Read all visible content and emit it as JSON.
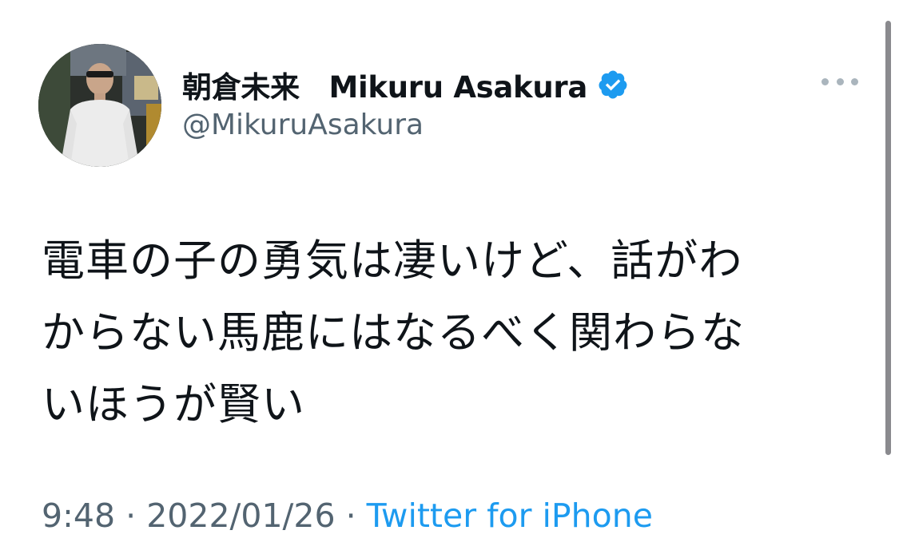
{
  "author": {
    "display_name": "朝倉未来　Mikuru Asakura",
    "handle": "@MikuruAsakura",
    "verified_icon": "verified-badge-icon",
    "avatar": "profile-photo"
  },
  "menu_icon": "more-horizontal-icon",
  "tweet": {
    "lines": [
      "電車の子の勇気は凄いけど、話がわ",
      "からない馬鹿にはなるべく関わらな",
      "いほうが賢い"
    ]
  },
  "meta": {
    "time": "9:48",
    "separator": "·",
    "date": "2022/01/26",
    "source": "Twitter for iPhone"
  },
  "colors": {
    "text": "#0f1419",
    "secondary": "#536471",
    "accent": "#1d9bf0",
    "verified": "#1d9bf0"
  }
}
